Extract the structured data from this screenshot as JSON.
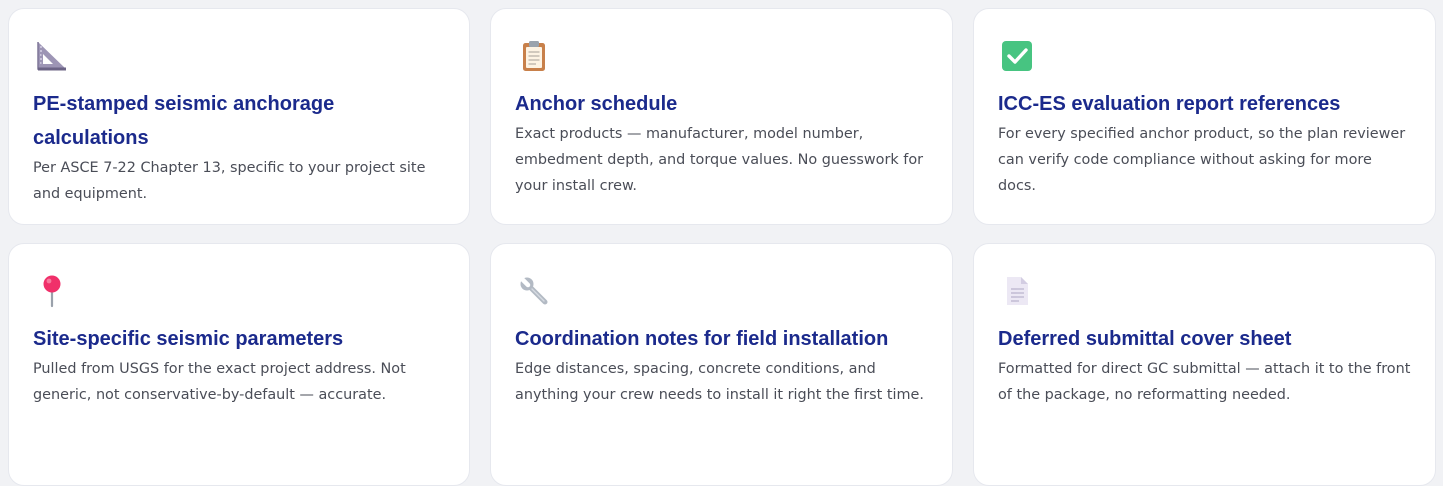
{
  "cards": [
    {
      "icon": "triangular-ruler-icon",
      "title": "PE-stamped seismic anchorage calculations",
      "description": "Per ASCE 7-22 Chapter 13, specific to your project site and equipment."
    },
    {
      "icon": "clipboard-icon",
      "title": "Anchor schedule",
      "description": "Exact products — manufacturer, model number, embedment depth, and torque values. No guesswork for your install crew."
    },
    {
      "icon": "check-mark-button-icon",
      "title": "ICC-ES evaluation report references",
      "description": "For every specified anchor product, so the plan reviewer can verify code compliance without asking for more docs."
    },
    {
      "icon": "round-pushpin-icon",
      "title": "Site-specific seismic parameters",
      "description": "Pulled from USGS for the exact project address. Not generic, not conservative-by-default — accurate."
    },
    {
      "icon": "wrench-icon",
      "title": "Coordination notes for field installation",
      "description": "Edge distances, spacing, concrete conditions, and anything your crew needs to install it right the first time."
    },
    {
      "icon": "page-facing-up-icon",
      "title": "Deferred submittal cover sheet",
      "description": "Formatted for direct GC submittal — attach it to the front of the package, no reformatting needed."
    }
  ],
  "colors": {
    "page_background": "#f1f2f5",
    "card_background": "#ffffff",
    "title": "#1b2a8c",
    "text": "#4a4d57"
  }
}
